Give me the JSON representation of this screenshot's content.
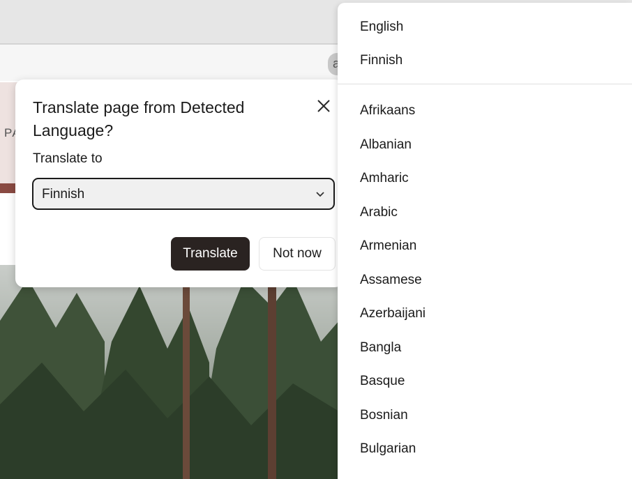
{
  "browser": {
    "address_glyph": "a"
  },
  "page": {
    "partial_text": "PΑ"
  },
  "dialog": {
    "title": "Translate page from Detected Language?",
    "translate_to_label": "Translate to",
    "selected_language": "Finnish",
    "translate_button": "Translate",
    "not_now_button": "Not now",
    "close_icon": "close-icon",
    "chevron_icon": "chevron-down-icon"
  },
  "dropdown": {
    "pinned": [
      "English",
      "Finnish"
    ],
    "languages": [
      "Afrikaans",
      "Albanian",
      "Amharic",
      "Arabic",
      "Armenian",
      "Assamese",
      "Azerbaijani",
      "Bangla",
      "Basque",
      "Bosnian",
      "Bulgarian"
    ]
  },
  "colors": {
    "primary_button": "#2a2321",
    "page_accent": "#8a4a42"
  }
}
